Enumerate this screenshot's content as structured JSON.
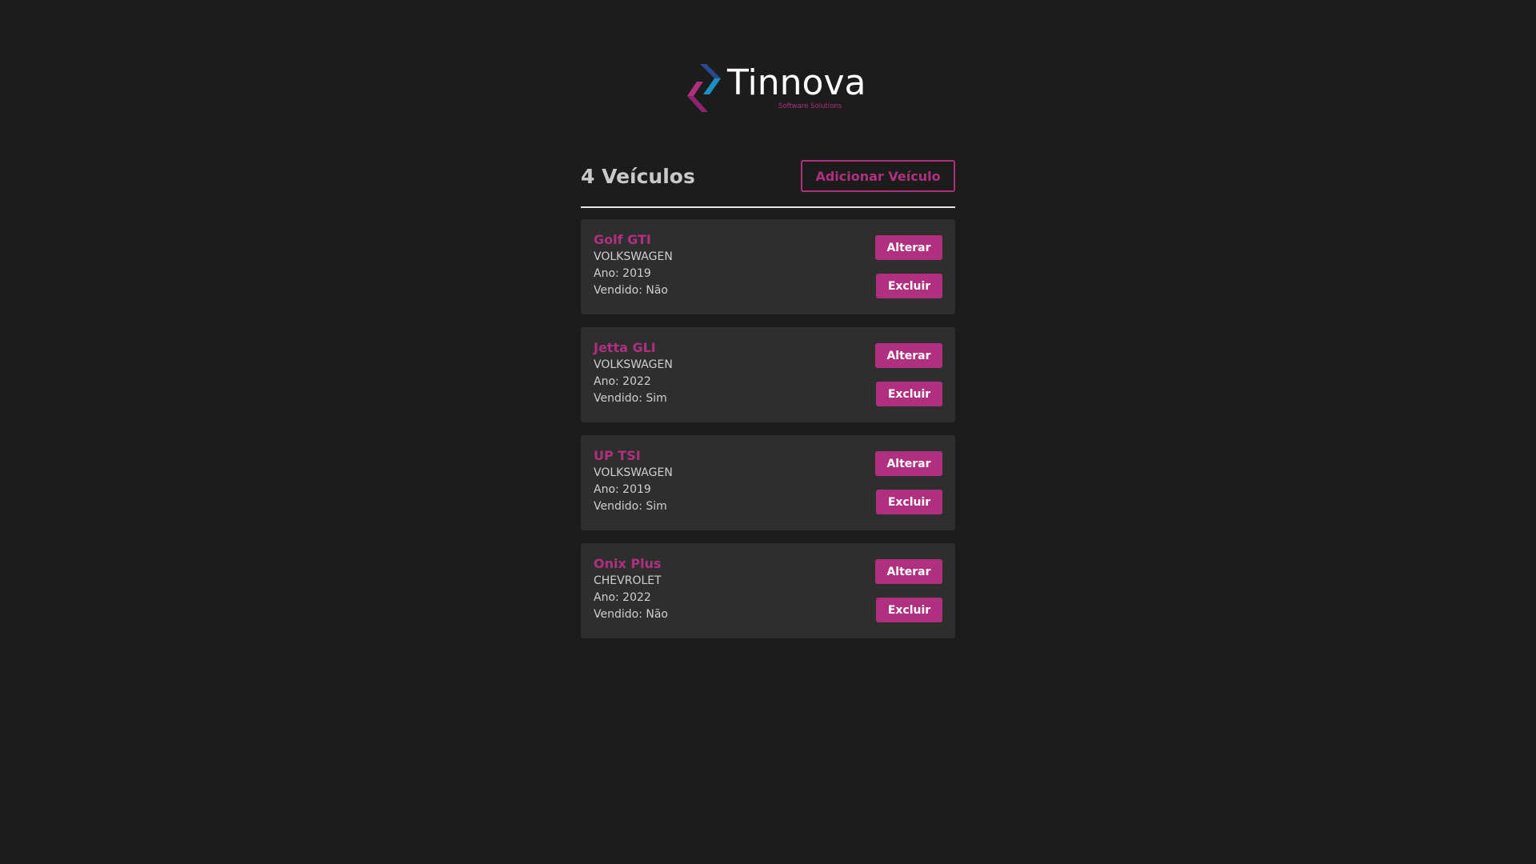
{
  "logo": {
    "name": "Tinnova",
    "tagline": "Software Solutions",
    "colors": {
      "magenta": "#b0307f",
      "blue": "#1a8fc4",
      "navy": "#2a4a8a"
    }
  },
  "header": {
    "count_title": "4 Veículos",
    "add_button_label": "Adicionar Veículo"
  },
  "labels": {
    "year_prefix": "Ano: ",
    "sold_prefix": "Vendido: ",
    "edit_button": "Alterar",
    "delete_button": "Excluir"
  },
  "vehicles": [
    {
      "name": "Golf GTI",
      "brand": "VOLKSWAGEN",
      "year_text": "Ano: 2019",
      "sold_text": "Vendido: Não"
    },
    {
      "name": "Jetta GLI",
      "brand": "VOLKSWAGEN",
      "year_text": "Ano: 2022",
      "sold_text": "Vendido: Sim"
    },
    {
      "name": "UP TSI",
      "brand": "VOLKSWAGEN",
      "year_text": "Ano: 2019",
      "sold_text": "Vendido: Sim"
    },
    {
      "name": "Onix Plus",
      "brand": "CHEVROLET",
      "year_text": "Ano: 2022",
      "sold_text": "Vendido: Não"
    }
  ],
  "colors": {
    "background": "#1c1c1c",
    "card": "#2e2e2e",
    "accent": "#b0307f",
    "text": "#cfcfcf",
    "divider": "#e6e6e6"
  }
}
